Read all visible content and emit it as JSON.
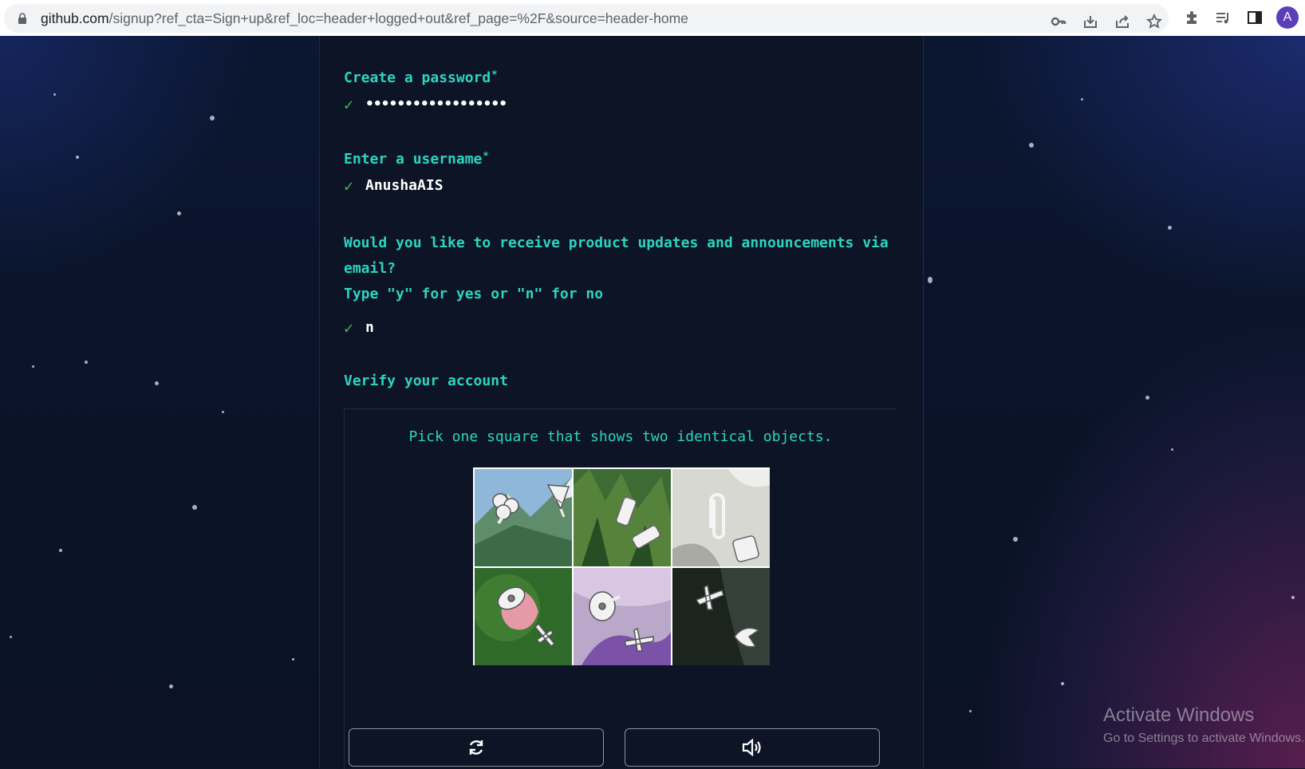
{
  "browser": {
    "url_host": "github.com",
    "url_path": "/signup?ref_cta=Sign+up&ref_loc=header+logged+out&ref_page=%2F&source=header-home",
    "toolbar_icons": [
      "lock-icon",
      "key-icon",
      "install-icon",
      "share-icon",
      "bookmark-star-icon",
      "extensions-icon",
      "media-queue-icon",
      "side-panel-icon"
    ],
    "profile_initial": "A",
    "profile_color": "#5b3fb8"
  },
  "form": {
    "password": {
      "label": "Create a password",
      "required_mark": "*",
      "masked_value": "••••••••••••••••••",
      "check": "✓"
    },
    "username": {
      "label": "Enter a username",
      "required_mark": "*",
      "value": "AnushaAIS",
      "check": "✓"
    },
    "email_updates": {
      "question_line1": "Would you like to receive product updates and announcements via",
      "question_line2": "email?",
      "hint": "Type \"y\" for yes or \"n\" for no",
      "value": "n",
      "check": "✓"
    },
    "verify": {
      "heading": "Verify your account",
      "instruction": "Pick one square that shows two identical objects."
    }
  },
  "captcha": {
    "tiles": [
      {
        "name": "tile-1",
        "objects": [
          "clover",
          "umbrella"
        ]
      },
      {
        "name": "tile-2",
        "objects": [
          "marker",
          "marker"
        ]
      },
      {
        "name": "tile-3",
        "objects": [
          "paperclip",
          "backpack"
        ]
      },
      {
        "name": "tile-4",
        "objects": [
          "satellite-dish",
          "airplane"
        ]
      },
      {
        "name": "tile-5",
        "objects": [
          "satellite-dish",
          "airplane"
        ]
      },
      {
        "name": "tile-6",
        "objects": [
          "airplane",
          "bird"
        ]
      }
    ],
    "refresh_icon": "refresh-icon",
    "audio_icon": "speaker-icon"
  },
  "watermark": {
    "title": "Activate Windows",
    "subtitle": "Go to Settings to activate Windows."
  },
  "colors": {
    "accent": "#2dd4c0",
    "check": "#3fb950",
    "panel": "#0d1426"
  }
}
